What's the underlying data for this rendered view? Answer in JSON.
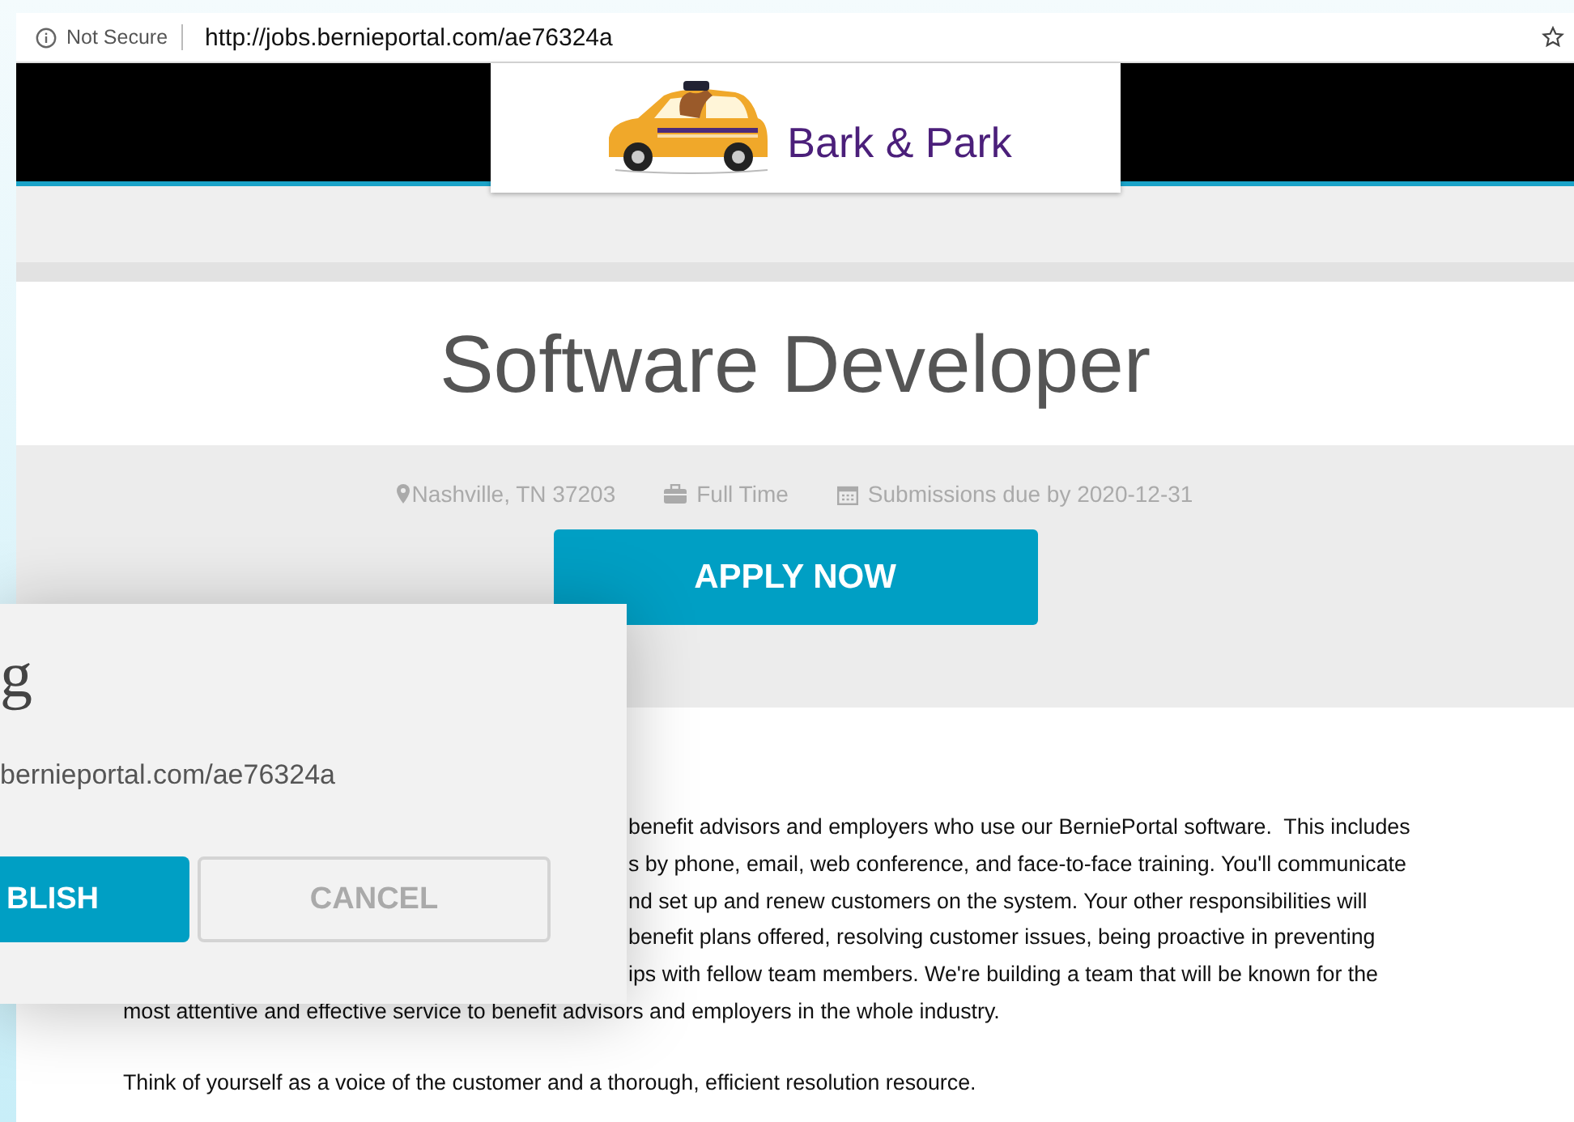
{
  "browser": {
    "security_label": "Not Secure",
    "url": "http://jobs.bernieportal.com/ae76324a"
  },
  "header": {
    "logo_text": "Bark & Park"
  },
  "job": {
    "title": "Software Developer",
    "meta": [
      {
        "kind": "location",
        "text": "Nashville, TN 37203"
      },
      {
        "kind": "type",
        "text": "Full Time"
      },
      {
        "kind": "deadline",
        "text": "Submissions due by 2020-12-31"
      }
    ],
    "apply_button": "APPLY NOW"
  },
  "description": {
    "paragraphs": [
      {
        "lines": [
          {
            "text": "benefit advisors and employers who use our BerniePortal software.  This includes",
            "covered": true
          },
          {
            "text": "s by phone, email, web conference, and face-to-face training. You'll communicate",
            "covered": true
          },
          {
            "text": "nd set up and renew customers on the system. Your other responsibilities will",
            "covered": true
          },
          {
            "text": "benefit plans offered, resolving customer issues, being proactive in preventing",
            "covered": true
          },
          {
            "text": "ips with fellow team members. We're building a team that will be known for the",
            "covered": true
          },
          {
            "text": "most attentive and effective service to benefit advisors and employers in the whole industry.",
            "covered": false
          }
        ]
      },
      {
        "lines": [
          {
            "text": "Think of yourself as a voice of the customer and a thorough, efficient resolution resource.",
            "covered": false
          }
        ]
      }
    ]
  },
  "dialog": {
    "title": "g",
    "url": "bernieportal.com/ae76324a",
    "buttons": [
      {
        "label": "BLISH",
        "kind": "primary"
      },
      {
        "label": "CANCEL",
        "kind": "secondary"
      }
    ]
  }
}
